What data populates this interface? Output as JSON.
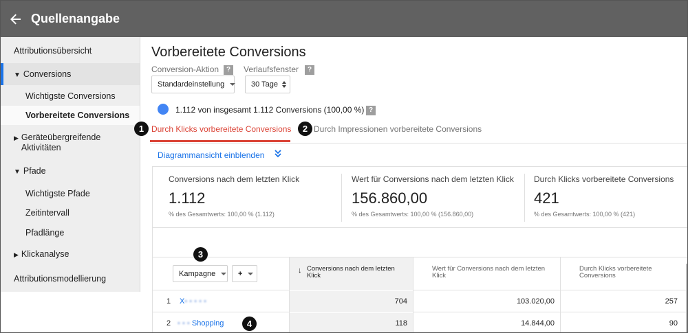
{
  "header": {
    "title": "Quellenangabe",
    "back_icon": "arrow-left-icon"
  },
  "sidebar": {
    "items": [
      {
        "label": "Attributionsübersicht"
      },
      {
        "label": "Conversions",
        "marker": "▼"
      },
      {
        "label": "Wichtigste Conversions"
      },
      {
        "label": "Vorbereitete Conversions"
      },
      {
        "label": "Geräteübergreifende Aktivitäten",
        "marker": "▶"
      },
      {
        "label": "Pfade",
        "marker": "▼"
      },
      {
        "label": "Wichtigste Pfade"
      },
      {
        "label": "Zeitintervall"
      },
      {
        "label": "Pfadlänge"
      },
      {
        "label": "Klickanalyse",
        "marker": "▶"
      },
      {
        "label": "Attributionsmodellierung"
      }
    ]
  },
  "main": {
    "title": "Vorbereitete Conversions",
    "conversion_action_label": "Conversion-Aktion",
    "conversion_action_value": "Standardeinstellung",
    "lookback_label": "Verlaufsfenster",
    "lookback_value": "30 Tage",
    "help": "?",
    "summary": "1.112 von insgesamt 1.112 Conversions (100,00 %)",
    "tabs": [
      {
        "label": "Durch Klicks vorbereitete Conversions",
        "active": true
      },
      {
        "label": "Durch Impressionen vorbereitete Conversions",
        "active": false
      }
    ],
    "badges": [
      "1",
      "2",
      "3",
      "4"
    ],
    "diagram_link": "Diagrammansicht einblenden",
    "cards": [
      {
        "title": "Conversions nach dem letzten Klick",
        "value": "1.112",
        "sub": "% des Gesamtwerts: 100,00 % (1.112)"
      },
      {
        "title": "Wert für Conversions nach dem letzten Klick",
        "value": "156.860,00",
        "sub": "% des Gesamtwerts: 100,00 % (156.860,00)"
      },
      {
        "title": "Durch Klicks vorbereitete Conversions",
        "value": "421",
        "sub": "% des Gesamtwerts: 100,00 % (421)"
      }
    ],
    "table": {
      "dimension_select": "Kampagne",
      "add_select": "+",
      "sort_icon": "arrow-down-icon",
      "columns": [
        "Conversions nach dem letzten Klick",
        "Wert für Conversions nach dem letzten Klick",
        "Durch Klicks vorbereitete Conversions"
      ],
      "rows": [
        {
          "index": "1",
          "name_hidden": "X",
          "name": "",
          "c1": "704",
          "c2": "103.020,00",
          "c3": "257"
        },
        {
          "index": "2",
          "name_hidden": "",
          "name": "Shopping",
          "c1": "118",
          "c2": "14.844,00",
          "c3": "90"
        }
      ]
    }
  },
  "colors": {
    "header": "#616161",
    "accent_red": "#db4437",
    "link_blue": "#1a73e8",
    "dot_blue": "#4285f4"
  }
}
